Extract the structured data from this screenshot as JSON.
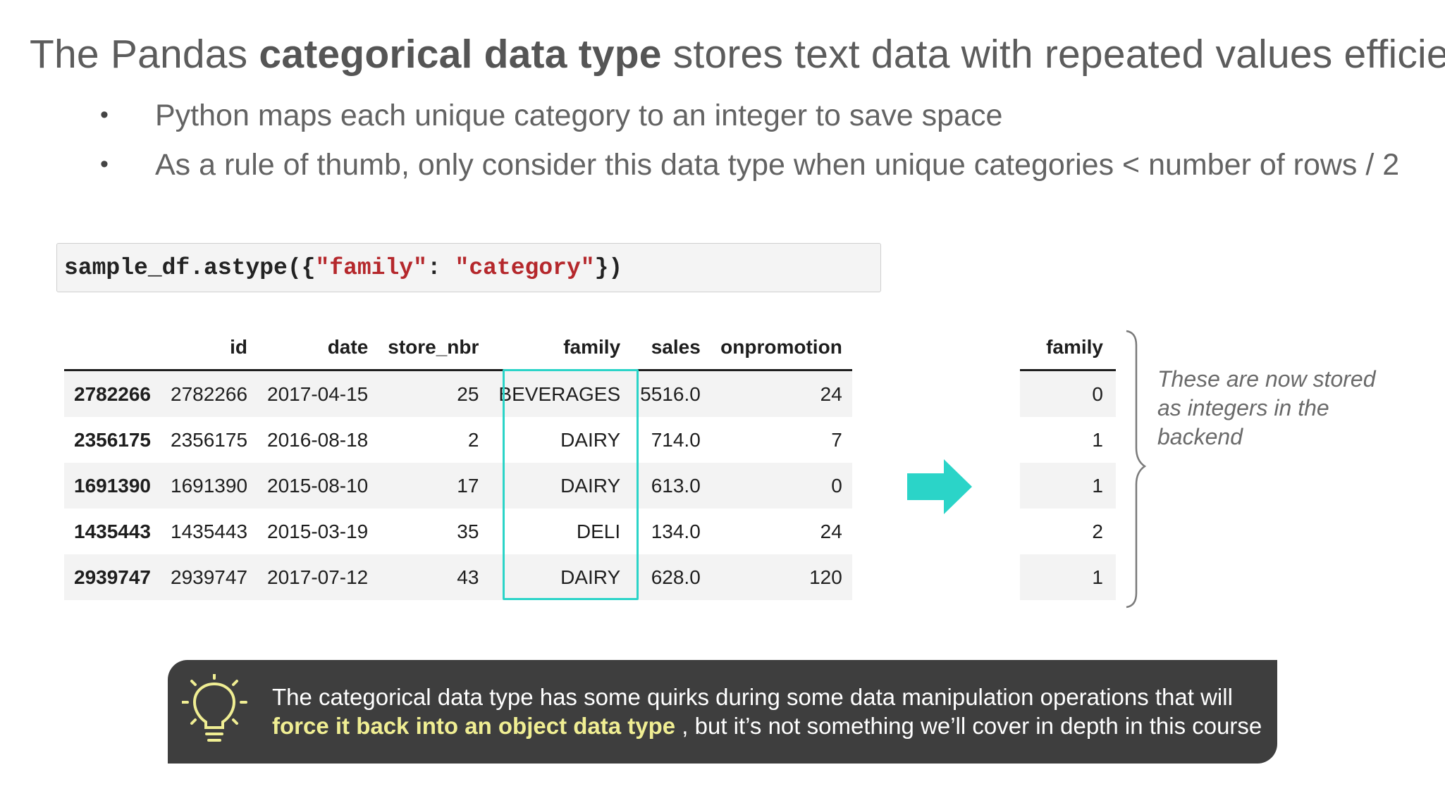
{
  "title": {
    "before": "The Pandas ",
    "bold": "categorical data type",
    "after": " stores text data with repeated values efficiently"
  },
  "bullets": [
    "Python maps each unique category to an integer to save space",
    "As a rule of thumb, only consider this data type when unique categories < number of rows / 2"
  ],
  "code": {
    "prefix": "sample_df.astype({",
    "key": "\"family\"",
    "sep": ": ",
    "value": "\"category\"",
    "suffix": "})"
  },
  "dataframe": {
    "columns": [
      "",
      "id",
      "date",
      "store_nbr",
      "family",
      "sales",
      "onpromotion"
    ],
    "rows": [
      [
        "2782266",
        "2782266",
        "2017-04-15",
        "25",
        "BEVERAGES",
        "5516.0",
        "24"
      ],
      [
        "2356175",
        "2356175",
        "2016-08-18",
        "2",
        "DAIRY",
        "714.0",
        "7"
      ],
      [
        "1691390",
        "1691390",
        "2015-08-10",
        "17",
        "DAIRY",
        "613.0",
        "0"
      ],
      [
        "1435443",
        "1435443",
        "2015-03-19",
        "35",
        "DELI",
        "134.0",
        "24"
      ],
      [
        "2939747",
        "2939747",
        "2017-07-12",
        "43",
        "DAIRY",
        "628.0",
        "120"
      ]
    ]
  },
  "codes_table": {
    "header": "family",
    "values": [
      "0",
      "1",
      "1",
      "2",
      "1"
    ]
  },
  "note": "These are now stored as integers in the backend",
  "callout": {
    "text1": "The categorical data type has some quirks during some data manipulation operations that will ",
    "highlight": "force it back into an object data type",
    "text2": " , but it’s not something we’ll cover in depth in this course"
  },
  "colors": {
    "accent": "#2bd4c8",
    "callout_bg": "#3e3e3e",
    "callout_highlight": "#f0ee93",
    "code_string": "#b5282c"
  },
  "icons": [
    "arrow-right-icon",
    "lightbulb-icon",
    "curly-brace-icon"
  ]
}
